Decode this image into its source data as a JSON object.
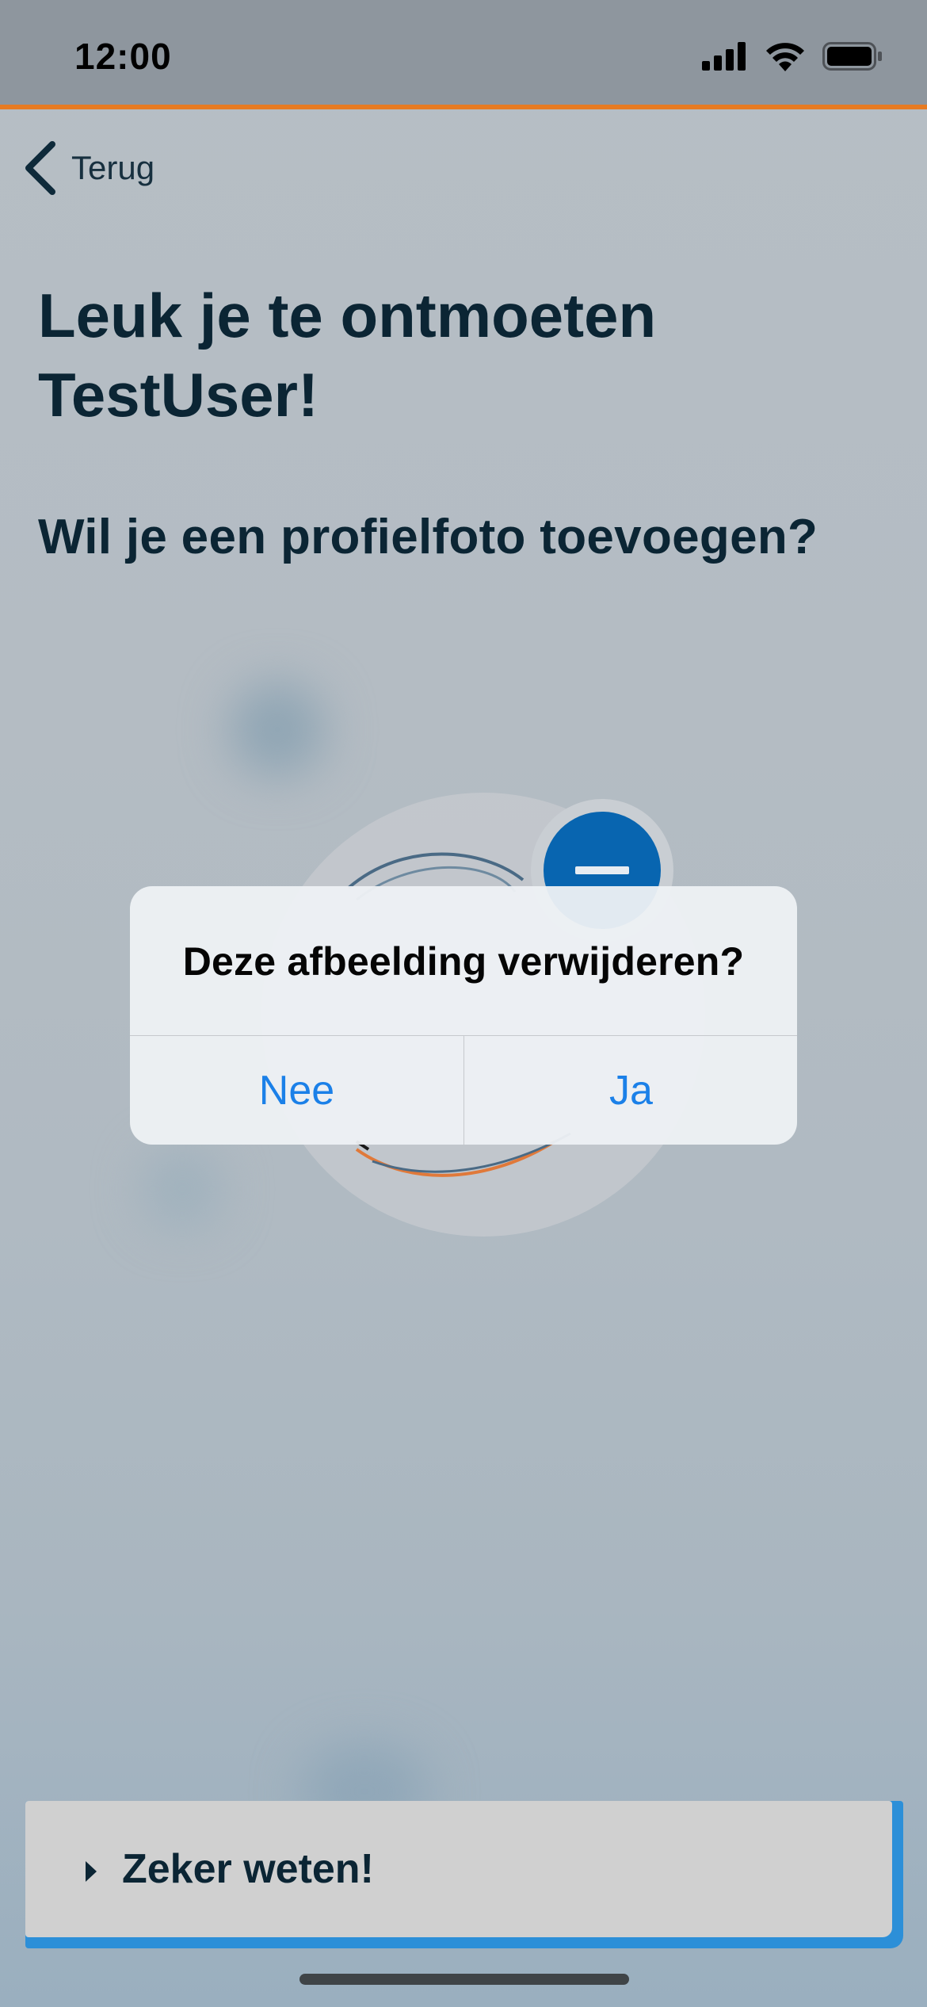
{
  "status_bar": {
    "time": "12:00"
  },
  "nav": {
    "back_label": "Terug"
  },
  "heading": {
    "title_line1": "Leuk je te ontmoeten",
    "title_line2": "TestUser!",
    "question": "Wil je een profielfoto toevoegen?"
  },
  "dialog": {
    "title": "Deze afbeelding verwijderen?",
    "cancel_label": "Nee",
    "confirm_label": "Ja"
  },
  "cta": {
    "label": "Zeker weten!"
  },
  "colors": {
    "accent_orange": "#e77b22",
    "primary_blue": "#0865b0",
    "dialog_button_blue": "#1b80e8",
    "heading_navy": "#0b2534"
  }
}
